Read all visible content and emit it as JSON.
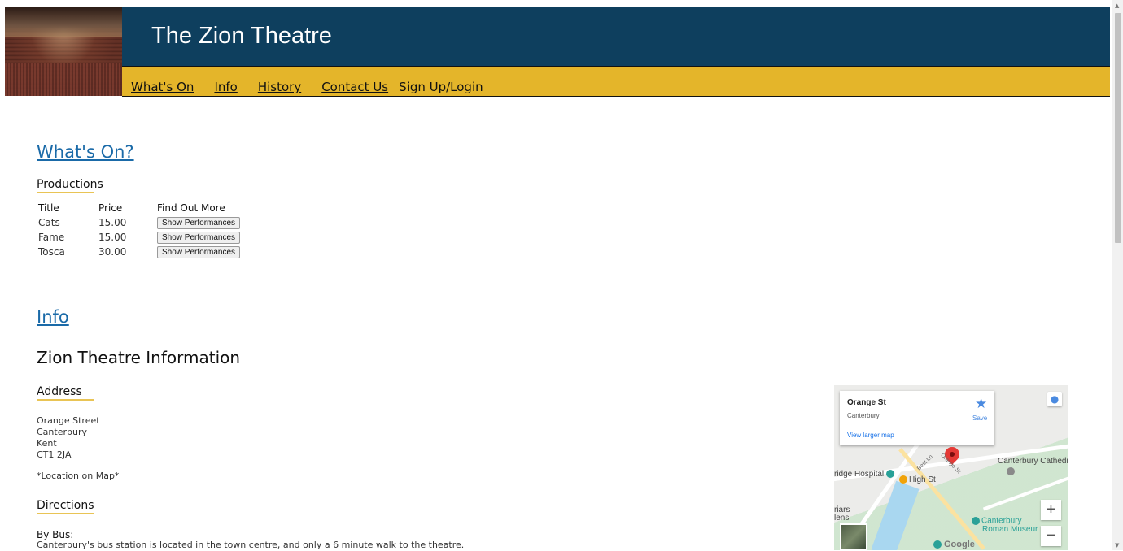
{
  "header": {
    "title": "The Zion Theatre",
    "nav": [
      "What's On",
      "Info",
      "History",
      "Contact Us",
      "Sign Up/Login"
    ]
  },
  "whats_on": {
    "heading": "What's On?",
    "productions_heading": "Productions",
    "table_headers": [
      "Title",
      "Price",
      "Find Out More"
    ],
    "rows": [
      {
        "title": "Cats",
        "price": "15.00",
        "button": "Show Performances"
      },
      {
        "title": "Fame",
        "price": "15.00",
        "button": "Show Performances"
      },
      {
        "title": "Tosca",
        "price": "30.00",
        "button": "Show Performances"
      }
    ]
  },
  "info": {
    "heading": "Info",
    "title": "Zion Theatre Information",
    "address_heading": "Address",
    "address_lines": [
      "Orange Street",
      "Canterbury",
      "Kent",
      "CT1 2JA"
    ],
    "location_note": "*Location on Map*",
    "directions_heading": "Directions",
    "by_bus_label": "By Bus:",
    "by_bus_text": "Canterbury's bus station is located in the town centre, and only a 6 minute walk to the theatre."
  },
  "map": {
    "place_name": "Orange St",
    "place_city": "Canterbury",
    "larger_map_link": "View larger map",
    "save_label": "Save",
    "labels": {
      "hospital": "ridge Hospital",
      "high_st": "High St",
      "cathedral": "Canterbury Cathedr",
      "museum_1": "Canterbury",
      "museum_2": "Roman Museur",
      "friars_1": "riars",
      "friars_2": "lens",
      "orange_st_road": "Orange St",
      "best_ln": "Best Ln",
      "google": "Google"
    },
    "zoom_in": "+",
    "zoom_out": "−"
  }
}
